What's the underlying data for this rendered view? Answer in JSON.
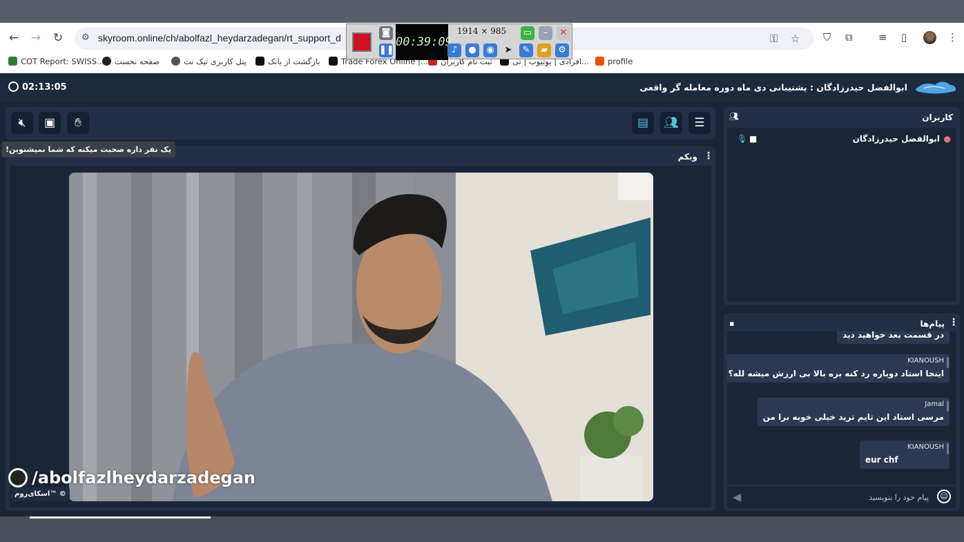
{
  "browser": {
    "url": "skyroom.online/ch/abolfazl_heydarzadegan/rt_support_d",
    "bookmarks": [
      {
        "label": "COT Report: SWISS...",
        "color": "#2e7d32"
      },
      {
        "label": "صفحه نخست",
        "color": "#222222"
      },
      {
        "label": "پنل کاربری تیک نت",
        "color": "#444444"
      },
      {
        "label": "بازگشت از بانک",
        "color": "#111111"
      },
      {
        "label": "Trade Forex Online |...",
        "color": "#111111"
      },
      {
        "label": "ثبت نام کاربران",
        "color": "#c62828"
      },
      {
        "label": "افرادی | یوتیوب | تی...",
        "color": "#111111"
      },
      {
        "label": "profile",
        "color": "#e65100"
      }
    ]
  },
  "recorder": {
    "time": "00:39:09",
    "resolution": "1914 × 985"
  },
  "header": {
    "timer": "02:13:05",
    "room_title": "ابوالفضل حیدرزادگان : پشتیبانی دی ماه دوره معامله گر واقعی"
  },
  "toolbar": {
    "tooltip": "یک نفر داره صحبت میکنه که شما نمیشنوین!"
  },
  "webcam": {
    "title": "وبکم",
    "watermark": "/abolfazlheydarzadegan",
    "brand": "اسکای‌روم™ ©"
  },
  "users": {
    "title": "کاربران",
    "list": [
      {
        "name": "ابوالفضل حیدرزادگان"
      }
    ]
  },
  "messages": {
    "title": "پیام‌ها",
    "items": [
      {
        "author": "",
        "text": "در قسمت بعد خواهید دید"
      },
      {
        "author": "KIANOUSH",
        "text": "اینجا استاد دوباره رد کنه بره بالا بی ارزش میشه لله؟"
      },
      {
        "author": "Jamal",
        "text": "مرسی استاد این تایم ترید خیلی خوبه برا من"
      },
      {
        "author": "KIANOUSH",
        "text": "eur chf"
      }
    ],
    "input_placeholder": "پیام خود را بنویسید"
  }
}
